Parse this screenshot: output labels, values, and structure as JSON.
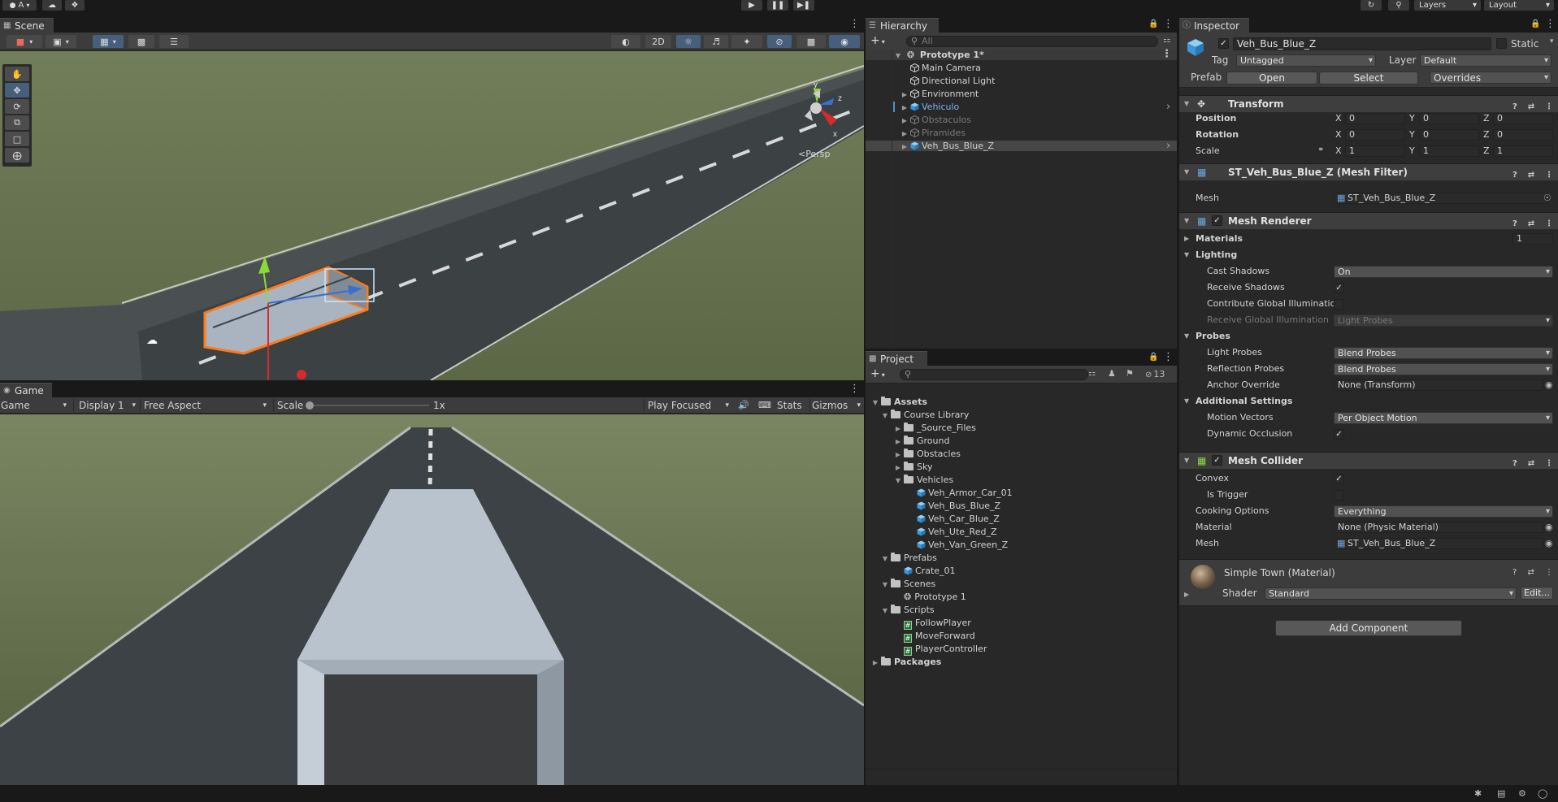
{
  "topbar": {
    "account_label": "A",
    "layers_label": "Layers",
    "layout_label": "Layout"
  },
  "scene": {
    "tab_label": "Scene",
    "persp_label": "Persp",
    "toolbar_2d_label": "2D",
    "gizmo_axes": [
      "y",
      "z",
      "x"
    ]
  },
  "game": {
    "tab_label": "Game",
    "mode_value": "Game",
    "display_value": "Display 1",
    "aspect_value": "Free Aspect",
    "scale_label": "Scale",
    "scale_value": "1x",
    "play_mode_value": "Play Focused",
    "stats_label": "Stats",
    "gizmos_label": "Gizmos"
  },
  "hierarchy": {
    "tab_label": "Hierarchy",
    "search_placeholder": "All",
    "scene_name": "Prototype 1*",
    "items": [
      {
        "label": "Main Camera",
        "arrow": false
      },
      {
        "label": "Directional Light",
        "arrow": false
      },
      {
        "label": "Environment",
        "arrow": true
      },
      {
        "label": "Vehiculo",
        "arrow": true
      },
      {
        "label": "Obstaculos",
        "arrow": true
      },
      {
        "label": "Piramides",
        "arrow": true
      },
      {
        "label": "Veh_Bus_Blue_Z",
        "arrow": true
      }
    ]
  },
  "project": {
    "tab_label": "Project",
    "count_badge": "13",
    "tree": [
      {
        "label": "Assets",
        "bold": true
      },
      {
        "label": "Course Library"
      },
      {
        "label": "_Source_Files"
      },
      {
        "label": "Ground"
      },
      {
        "label": "Obstacles"
      },
      {
        "label": "Sky"
      },
      {
        "label": "Vehicles"
      },
      {
        "label": "Veh_Armor_Car_01"
      },
      {
        "label": "Veh_Bus_Blue_Z"
      },
      {
        "label": "Veh_Car_Blue_Z"
      },
      {
        "label": "Veh_Ute_Red_Z"
      },
      {
        "label": "Veh_Van_Green_Z"
      },
      {
        "label": "Prefabs"
      },
      {
        "label": "Crate_01"
      },
      {
        "label": "Scenes"
      },
      {
        "label": "Prototype 1"
      },
      {
        "label": "Scripts"
      },
      {
        "label": "FollowPlayer"
      },
      {
        "label": "MoveForward"
      },
      {
        "label": "PlayerController"
      },
      {
        "label": "Packages",
        "bold": true
      }
    ]
  },
  "inspector": {
    "tab_label": "Inspector",
    "object_name": "Veh_Bus_Blue_Z",
    "static_label": "Static",
    "tag_label": "Tag",
    "tag_value": "Untagged",
    "layer_label": "Layer",
    "layer_value": "Default",
    "prefab_label": "Prefab",
    "open_label": "Open",
    "select_label": "Select",
    "overrides_label": "Overrides",
    "transform": {
      "title": "Transform",
      "position_label": "Position",
      "rotation_label": "Rotation",
      "scale_label": "Scale",
      "position": [
        "0",
        "0",
        "0"
      ],
      "rotation": [
        "0",
        "0",
        "0"
      ],
      "scale": [
        "1",
        "1",
        "1"
      ],
      "axis_x": "X",
      "axis_y": "Y",
      "axis_z": "Z"
    },
    "mesh_filter": {
      "title": "ST_Veh_Bus_Blue_Z (Mesh Filter)",
      "mesh_label": "Mesh",
      "mesh_value": "ST_Veh_Bus_Blue_Z"
    },
    "mesh_renderer": {
      "title": "Mesh Renderer",
      "materials_label": "Materials",
      "materials_count": "1",
      "lighting_label": "Lighting",
      "cast_shadows_label": "Cast Shadows",
      "cast_shadows_value": "On",
      "receive_shadows_label": "Receive Shadows",
      "contribute_gi_label": "Contribute Global Illuminatic",
      "receive_gi_label": "Receive Global Illumination",
      "receive_gi_value": "Light Probes",
      "probes_label": "Probes",
      "light_probes_label": "Light Probes",
      "light_probes_value": "Blend Probes",
      "reflection_probes_label": "Reflection Probes",
      "reflection_probes_value": "Blend Probes",
      "anchor_override_label": "Anchor Override",
      "anchor_override_value": "None (Transform)",
      "additional_label": "Additional Settings",
      "motion_vectors_label": "Motion Vectors",
      "motion_vectors_value": "Per Object Motion",
      "dynamic_occlusion_label": "Dynamic Occlusion"
    },
    "mesh_collider": {
      "title": "Mesh Collider",
      "convex_label": "Convex",
      "is_trigger_label": "Is Trigger",
      "cooking_label": "Cooking Options",
      "cooking_value": "Everything",
      "material_label": "Material",
      "material_value": "None (Physic Material)",
      "mesh_label": "Mesh",
      "mesh_value": "ST_Veh_Bus_Blue_Z"
    },
    "material": {
      "title": "Simple Town (Material)",
      "shader_label": "Shader",
      "shader_value": "Standard",
      "edit_label": "Edit..."
    },
    "add_component_label": "Add Component"
  },
  "colors": {
    "accent_blue": "#4f8fd6",
    "selection_orange": "#ff7a1a",
    "ground_green": "#6b7751",
    "road_gray": "#3d4246"
  }
}
